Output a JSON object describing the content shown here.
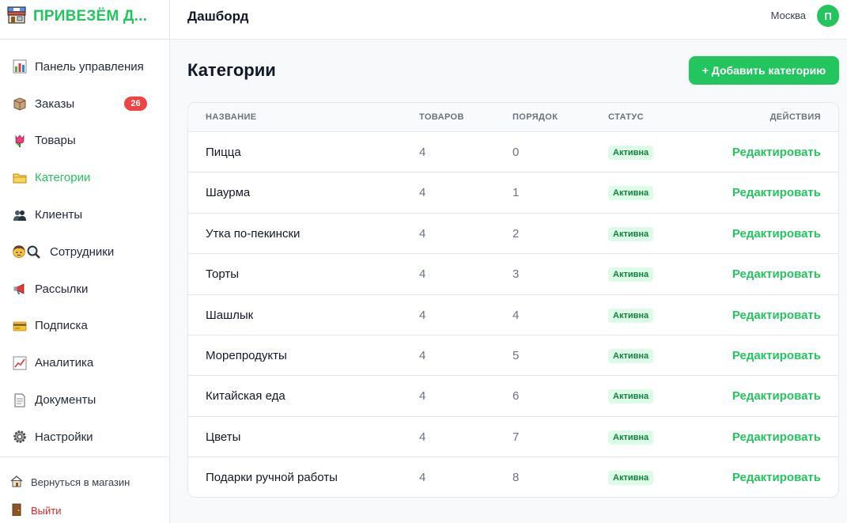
{
  "brand": {
    "name": "ПРИВЕЗЁМ Д...",
    "icon": "store-icon",
    "accent": "#22c55e"
  },
  "sidebar": {
    "items": [
      {
        "label": "Панель управления",
        "icon": "bar-chart-icon"
      },
      {
        "label": "Заказы",
        "icon": "package-icon",
        "badge": "26"
      },
      {
        "label": "Товары",
        "icon": "tulip-icon"
      },
      {
        "label": "Категории",
        "icon": "folder-icon",
        "active": true
      },
      {
        "label": "Клиенты",
        "icon": "users-icon"
      },
      {
        "label": "Сотрудники",
        "icon": "staff-icon"
      },
      {
        "label": "Рассылки",
        "icon": "megaphone-icon"
      },
      {
        "label": "Подписка",
        "icon": "credit-card-icon"
      },
      {
        "label": "Аналитика",
        "icon": "line-chart-icon"
      },
      {
        "label": "Документы",
        "icon": "document-icon"
      },
      {
        "label": "Настройки",
        "icon": "gear-icon"
      }
    ],
    "back_to_store": "Вернуться в магазин",
    "logout": "Выйти"
  },
  "topbar": {
    "title": "Дашборд",
    "city": "Москва",
    "avatar_letter": "П"
  },
  "main": {
    "title": "Категории",
    "add_button": "+ Добавить категорию",
    "columns": [
      "Название",
      "Товаров",
      "Порядок",
      "Статус",
      "Действия"
    ],
    "rows": [
      {
        "name": "Пицца",
        "count": "4",
        "order": "0",
        "status": "Активна",
        "action": "Редактировать"
      },
      {
        "name": "Шаурма",
        "count": "4",
        "order": "1",
        "status": "Активна",
        "action": "Редактировать"
      },
      {
        "name": "Утка по-пекински",
        "count": "4",
        "order": "2",
        "status": "Активна",
        "action": "Редактировать"
      },
      {
        "name": "Торты",
        "count": "4",
        "order": "3",
        "status": "Активна",
        "action": "Редактировать"
      },
      {
        "name": "Шашлык",
        "count": "4",
        "order": "4",
        "status": "Активна",
        "action": "Редактировать"
      },
      {
        "name": "Морепродукты",
        "count": "4",
        "order": "5",
        "status": "Активна",
        "action": "Редактировать"
      },
      {
        "name": "Китайская еда",
        "count": "4",
        "order": "6",
        "status": "Активна",
        "action": "Редактировать"
      },
      {
        "name": "Цветы",
        "count": "4",
        "order": "7",
        "status": "Активна",
        "action": "Редактировать"
      },
      {
        "name": "Подарки ручной работы",
        "count": "4",
        "order": "8",
        "status": "Активна",
        "action": "Редактировать"
      }
    ]
  }
}
